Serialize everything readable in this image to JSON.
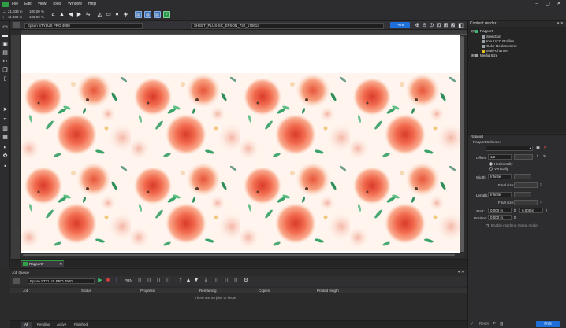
{
  "menu": {
    "items": [
      "File",
      "Edit",
      "View",
      "Tools",
      "Window",
      "Help"
    ]
  },
  "toolbar": {
    "width_value": "21.333 in",
    "width_pct": "100.00 %",
    "height_value": "11.333 in",
    "height_pct": "100.00 %",
    "icons": [
      "text-tool",
      "fill",
      "arrow-left",
      "arrow-right",
      "flip",
      "crop",
      "printer",
      "drop",
      "scan",
      "dashboard-1",
      "dashboard-2",
      "dashboard-3",
      "dashboard-4"
    ]
  },
  "document": {
    "printer": "Epson STYLUS PRO 4900",
    "profile": "SHEET_PLUS-SC_EPSON_720_170613",
    "print_label": "Print",
    "tab_label": "Rapport#"
  },
  "job_queue": {
    "title": "Job Queue",
    "printer": "Epson STYLUS PRO 4900",
    "columns": [
      "Job",
      "Status",
      "Progress",
      "Remaining",
      "Copies",
      "Printed length"
    ],
    "empty_message": "There are no jobs to show",
    "tabs": [
      "All",
      "Pending",
      "Active",
      "Finished"
    ],
    "active_tab": "All"
  },
  "content_render": {
    "title": "Content render",
    "tree": [
      {
        "label": "Rapport",
        "level": 0,
        "color": "#3cb371"
      },
      {
        "label": "Selection",
        "level": 1,
        "color": "#9aa0a6"
      },
      {
        "label": "Input ICC Profiles",
        "level": 1,
        "color": "#9aa0a6"
      },
      {
        "label": "Color Replacement",
        "level": 1,
        "color": "#9aa0a6"
      },
      {
        "label": "Multi-Channel",
        "level": 1,
        "color": "#e0c020"
      },
      {
        "label": "Media Size",
        "level": 0,
        "color": "#9aa0a6"
      }
    ]
  },
  "rapport": {
    "section_title": "Rapport",
    "scheme_label": "Rapport Scheme:",
    "offset_label": "Offset:",
    "offset_value": "1/2",
    "horizontally_label": "Horizontally",
    "vertically_label": "Vertically",
    "width_label": "Width:",
    "width_value": "Infinite",
    "final_size_label": "Final size:",
    "length_label": "Length:",
    "length_value": "Infinite",
    "start_label": "Start:",
    "start_x": "0.000 in",
    "start_y": "0.000 in",
    "position_label": "Position:",
    "position_value": "0.000 in",
    "machine_repeat_label": "Enable machine repeat mode",
    "reset_label": "Reset",
    "print_label": "Print"
  },
  "colors": {
    "accent": "#1e6fd9",
    "panel": "#2b2b2b",
    "rose": "#f26b4f",
    "leaf": "#3aa36a"
  }
}
